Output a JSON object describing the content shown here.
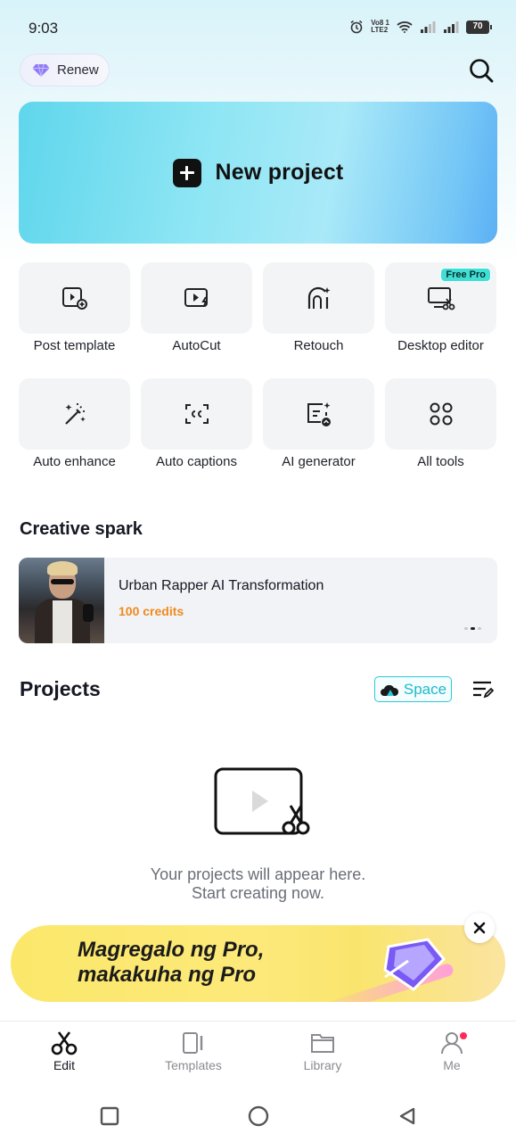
{
  "status_bar": {
    "time": "9:03",
    "battery": "70",
    "network_label_top": "Vo8 1",
    "network_label_bottom": "LTE2"
  },
  "header": {
    "renew_label": "Renew",
    "search_icon": "search-icon"
  },
  "new_project": {
    "label": "New project"
  },
  "tools": [
    {
      "label": "Post template",
      "icon": "post-template-icon"
    },
    {
      "label": "AutoCut",
      "icon": "autocut-icon"
    },
    {
      "label": "Retouch",
      "icon": "retouch-icon"
    },
    {
      "label": "Desktop editor",
      "icon": "desktop-editor-icon",
      "badge": "Free Pro"
    },
    {
      "label": "Auto enhance",
      "icon": "magic-wand-icon"
    },
    {
      "label": "Auto captions",
      "icon": "captions-icon"
    },
    {
      "label": "AI generator",
      "icon": "ai-generator-icon"
    },
    {
      "label": "All tools",
      "icon": "grid-icon"
    }
  ],
  "creative_spark": {
    "title": "Creative spark",
    "card": {
      "title": "Urban Rapper AI Transformation",
      "credits": "100 credits"
    }
  },
  "projects": {
    "title": "Projects",
    "space_label": "Space",
    "empty_line1": "Your projects will appear here.",
    "empty_line2": "Start creating now."
  },
  "promo": {
    "line1": "Magregalo ng Pro,",
    "line2": "makakuha ng Pro"
  },
  "tab_bar": {
    "tabs": [
      {
        "label": "Edit",
        "active": true
      },
      {
        "label": "Templates",
        "active": false
      },
      {
        "label": "Library",
        "active": false
      },
      {
        "label": "Me",
        "active": false
      }
    ]
  },
  "colors": {
    "accent": "#2cc9d6",
    "credits": "#f08a1c",
    "notification": "#fe2c55",
    "badge": "#3ee0d6"
  }
}
